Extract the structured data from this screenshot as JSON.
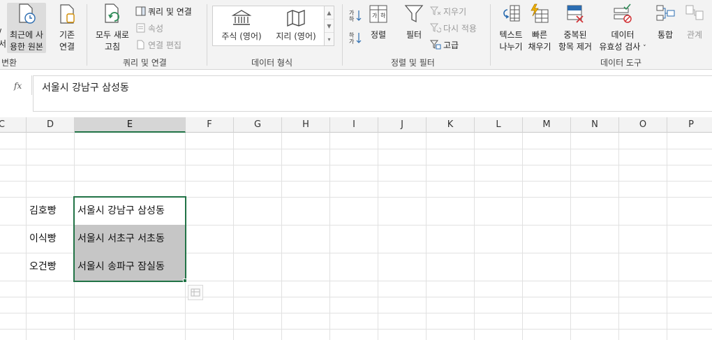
{
  "ribbon": {
    "get_transform": {
      "recent_sources_label_1": "최근에 사",
      "recent_sources_label_2": "용한 원본",
      "existing_connections_label_1": "기존",
      "existing_connections_label_2": "연결",
      "group_label_fragment": "변환",
      "left_clip_1": "/",
      "left_clip_2": "서"
    },
    "queries_connections": {
      "refresh_all_1": "모두 새로",
      "refresh_all_2": "고침",
      "queries_connections": "쿼리 및 연결",
      "properties": "속성",
      "edit_links": "연결 편집",
      "group_label": "쿼리 및 연결"
    },
    "data_types": {
      "stocks": "주식 (영어)",
      "geography": "지리 (영어)",
      "group_label": "데이터 형식"
    },
    "sort_filter": {
      "sort": "정렬",
      "filter": "필터",
      "clear": "지우기",
      "reapply": "다시 적용",
      "advanced": "고급",
      "group_label": "정렬 및 필터"
    },
    "data_tools": {
      "text_to_columns_1": "텍스트",
      "text_to_columns_2": "나누기",
      "flash_fill_1": "빠른",
      "flash_fill_2": "채우기",
      "remove_duplicates_1": "중복된",
      "remove_duplicates_2": "항목 제거",
      "data_validation_1": "데이터",
      "data_validation_2": "유효성 검사",
      "consolidate": "통합",
      "relationships": "관계",
      "group_label": "데이터 도구"
    }
  },
  "formula_bar": {
    "fx": "fx",
    "value": "서울시 강남구 삼성동"
  },
  "grid": {
    "columns": [
      "C",
      "D",
      "E",
      "F",
      "G",
      "H",
      "I",
      "J",
      "K",
      "L",
      "M",
      "N",
      "O",
      "P"
    ],
    "active_column": "E",
    "rows": [
      {
        "d": "김호빵",
        "e": "서울시 강남구 삼성동"
      },
      {
        "d": "이식빵",
        "e": "서울시 서초구 서초동"
      },
      {
        "d": "오건빵",
        "e": "서울시 송파구 잠실동"
      }
    ]
  },
  "colors": {
    "accent_green": "#217346",
    "ribbon_bg": "#f3f3f3",
    "selection_fill": "#c6c6c6"
  }
}
